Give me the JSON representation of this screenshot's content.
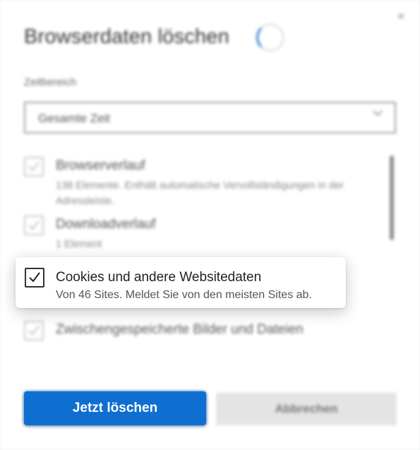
{
  "dialog": {
    "title": "Browserdaten löschen",
    "close_glyph": "×",
    "time_range": {
      "label": "Zeitbereich",
      "value": "Gesamte Zeit"
    },
    "items": [
      {
        "title": "Browserverlauf",
        "description": "138 Elemente. Enthält automatische Vervollständigungen in der Adressleiste.",
        "checked": true
      },
      {
        "title": "Downloadverlauf",
        "description": "1 Element",
        "checked": true
      },
      {
        "title": "Cookies und andere Websitedaten",
        "description": "Von 46 Sites. Meldet Sie von den meisten Sites ab.",
        "checked": true
      },
      {
        "title": "Zwischengespeicherte Bilder und Dateien",
        "description": "",
        "checked": true
      }
    ],
    "buttons": {
      "clear_label": "Jetzt löschen",
      "cancel_label": "Abbrechen"
    }
  },
  "colors": {
    "primary": "#0f6fd0",
    "spinner": "#2f7fd4"
  },
  "icons": {
    "close": "close-icon",
    "chevron": "chevron-down-icon",
    "check": "checkmark-icon",
    "spinner": "loading-spinner-icon"
  }
}
